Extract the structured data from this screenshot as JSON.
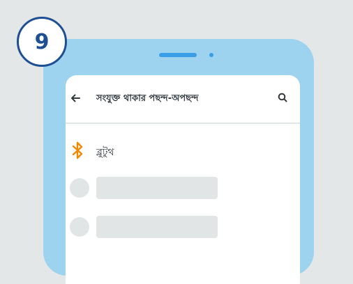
{
  "step": {
    "number": "9"
  },
  "app_bar": {
    "title": "সংযুক্ত থাকার পছন্দ-অপছন্দ",
    "back_icon": "back-arrow-icon",
    "search_icon": "search-icon"
  },
  "list": {
    "bluetooth": {
      "label": "ব্লুটুথ",
      "icon": "bluetooth-icon"
    },
    "placeholder_rows": 2
  },
  "colors": {
    "background": "#e3e7e8",
    "phone_body": "#9ed3ef",
    "phone_accent": "#3a9ee6",
    "badge_border": "#1f4f93",
    "bluetooth_orange": "#f28a00",
    "placeholder": "#e1e5e6"
  }
}
